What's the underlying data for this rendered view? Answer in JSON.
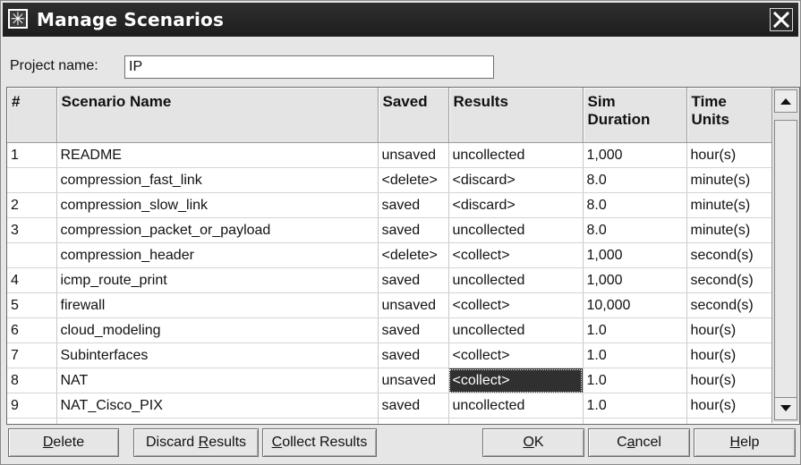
{
  "window": {
    "title": "Manage Scenarios"
  },
  "project": {
    "label": "Project name:",
    "value": "IP"
  },
  "table": {
    "headers": {
      "num": "#",
      "name": "Scenario Name",
      "saved": "Saved",
      "results": "Results",
      "sim_duration_1": "Sim",
      "sim_duration_2": "Duration",
      "time_units_1": "Time",
      "time_units_2": "Units"
    },
    "rows": [
      {
        "num": "1",
        "name": "README",
        "saved": "unsaved",
        "results": "uncollected",
        "duration": "1,000",
        "units": "hour(s)"
      },
      {
        "num": "",
        "name": "compression_fast_link",
        "saved": "<delete>",
        "results": "<discard>",
        "duration": "8.0",
        "units": "minute(s)"
      },
      {
        "num": "2",
        "name": "compression_slow_link",
        "saved": "saved",
        "results": "<discard>",
        "duration": "8.0",
        "units": "minute(s)"
      },
      {
        "num": "3",
        "name": "compression_packet_or_payload",
        "saved": "saved",
        "results": "uncollected",
        "duration": "8.0",
        "units": "minute(s)"
      },
      {
        "num": "",
        "name": "compression_header",
        "saved": "<delete>",
        "results": "<collect>",
        "duration": "1,000",
        "units": "second(s)"
      },
      {
        "num": "4",
        "name": "icmp_route_print",
        "saved": "saved",
        "results": "uncollected",
        "duration": "1,000",
        "units": "second(s)"
      },
      {
        "num": "5",
        "name": "firewall",
        "saved": "unsaved",
        "results": "<collect>",
        "duration": "10,000",
        "units": "second(s)"
      },
      {
        "num": "6",
        "name": "cloud_modeling",
        "saved": "saved",
        "results": "uncollected",
        "duration": "1.0",
        "units": "hour(s)"
      },
      {
        "num": "7",
        "name": "Subinterfaces",
        "saved": "saved",
        "results": "<collect>",
        "duration": "1.0",
        "units": "hour(s)"
      },
      {
        "num": "8",
        "name": "NAT",
        "saved": "unsaved",
        "results": "<collect>",
        "duration": "1.0",
        "units": "hour(s)",
        "selected_cell": "results"
      },
      {
        "num": "9",
        "name": "NAT_Cisco_PIX",
        "saved": "saved",
        "results": "uncollected",
        "duration": "1.0",
        "units": "hour(s)"
      }
    ]
  },
  "buttons": {
    "delete": {
      "u": "D",
      "rest": "elete"
    },
    "discard": {
      "pre": "Discard ",
      "u": "R",
      "rest": "esults"
    },
    "collect": {
      "u": "C",
      "rest": "ollect Results"
    },
    "ok": {
      "u": "O",
      "rest": "K"
    },
    "cancel": {
      "pre": "C",
      "u": "a",
      "rest": "ncel"
    },
    "help": {
      "u": "H",
      "rest": "elp"
    }
  },
  "icons": {
    "app": "asterisk-star-icon",
    "close": "close-icon",
    "scroll_up": "triangle-up-icon",
    "scroll_down": "triangle-down-icon"
  }
}
